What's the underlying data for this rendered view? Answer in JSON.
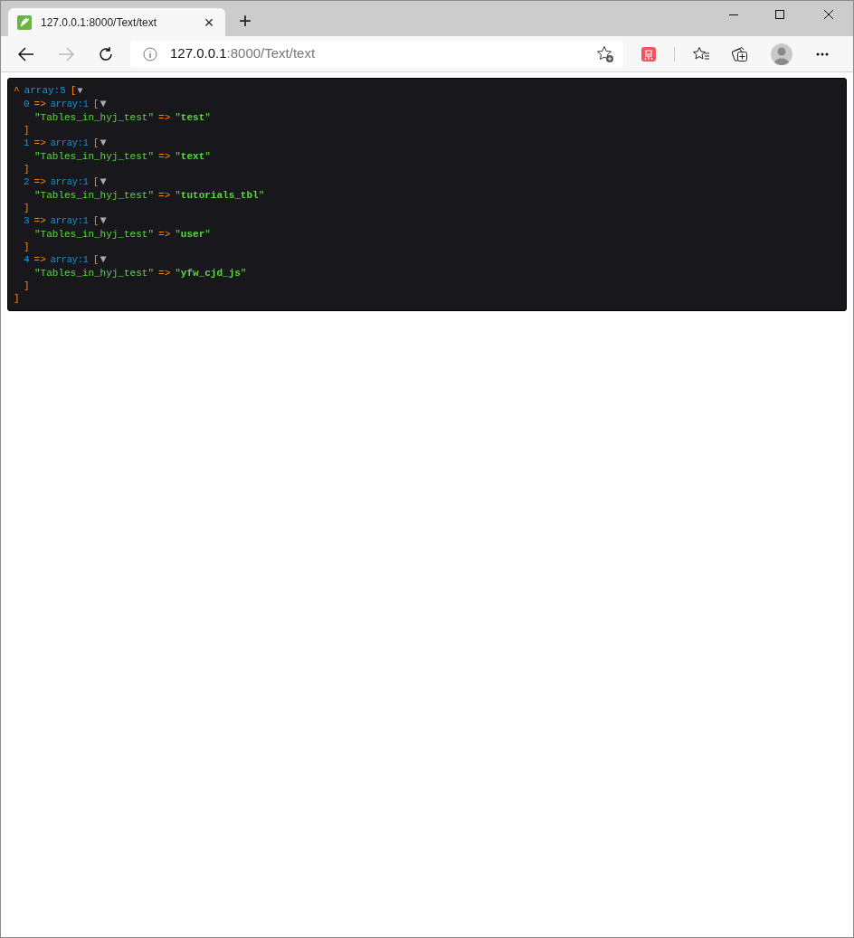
{
  "browser": {
    "tab": {
      "title": "127.0.0.1:8000/Text/text",
      "close": "×"
    },
    "new_tab": "+",
    "address": {
      "host": "127.0.0.1",
      "path": ":8000/Text/text"
    }
  },
  "dump": {
    "collapse": "^",
    "type": "array:5",
    "open": "[",
    "toggle": "▼",
    "close": "]",
    "items": [
      {
        "index": "0",
        "arrow": "=>",
        "type": "array:1",
        "open": "[",
        "toggle": "▼",
        "key": "\"Tables_in_hyj_test\"",
        "key_arrow": "=>",
        "value": "\"**test**\"",
        "close": "]"
      },
      {
        "index": "1",
        "arrow": "=>",
        "type": "array:1",
        "open": "[",
        "toggle": "▼",
        "key": "\"Tables_in_hyj_test\"",
        "key_arrow": "=>",
        "value": "\"**text**\"",
        "close": "]"
      },
      {
        "index": "2",
        "arrow": "=>",
        "type": "array:1",
        "open": "[",
        "toggle": "▼",
        "key": "\"Tables_in_hyj_test\"",
        "key_arrow": "=>",
        "value": "\"**tutorials_tbl**\"",
        "close": "]"
      },
      {
        "index": "3",
        "arrow": "=>",
        "type": "array:1",
        "open": "[",
        "toggle": "▼",
        "key": "\"Tables_in_hyj_test\"",
        "key_arrow": "=>",
        "value": "\"**user**\"",
        "close": "]"
      },
      {
        "index": "4",
        "arrow": "=>",
        "type": "array:1",
        "open": "[",
        "toggle": "▼",
        "key": "\"Tables_in_hyj_test\"",
        "key_arrow": "=>",
        "value": "\"**yfw_cjd_js**\"",
        "close": "]"
      }
    ]
  }
}
